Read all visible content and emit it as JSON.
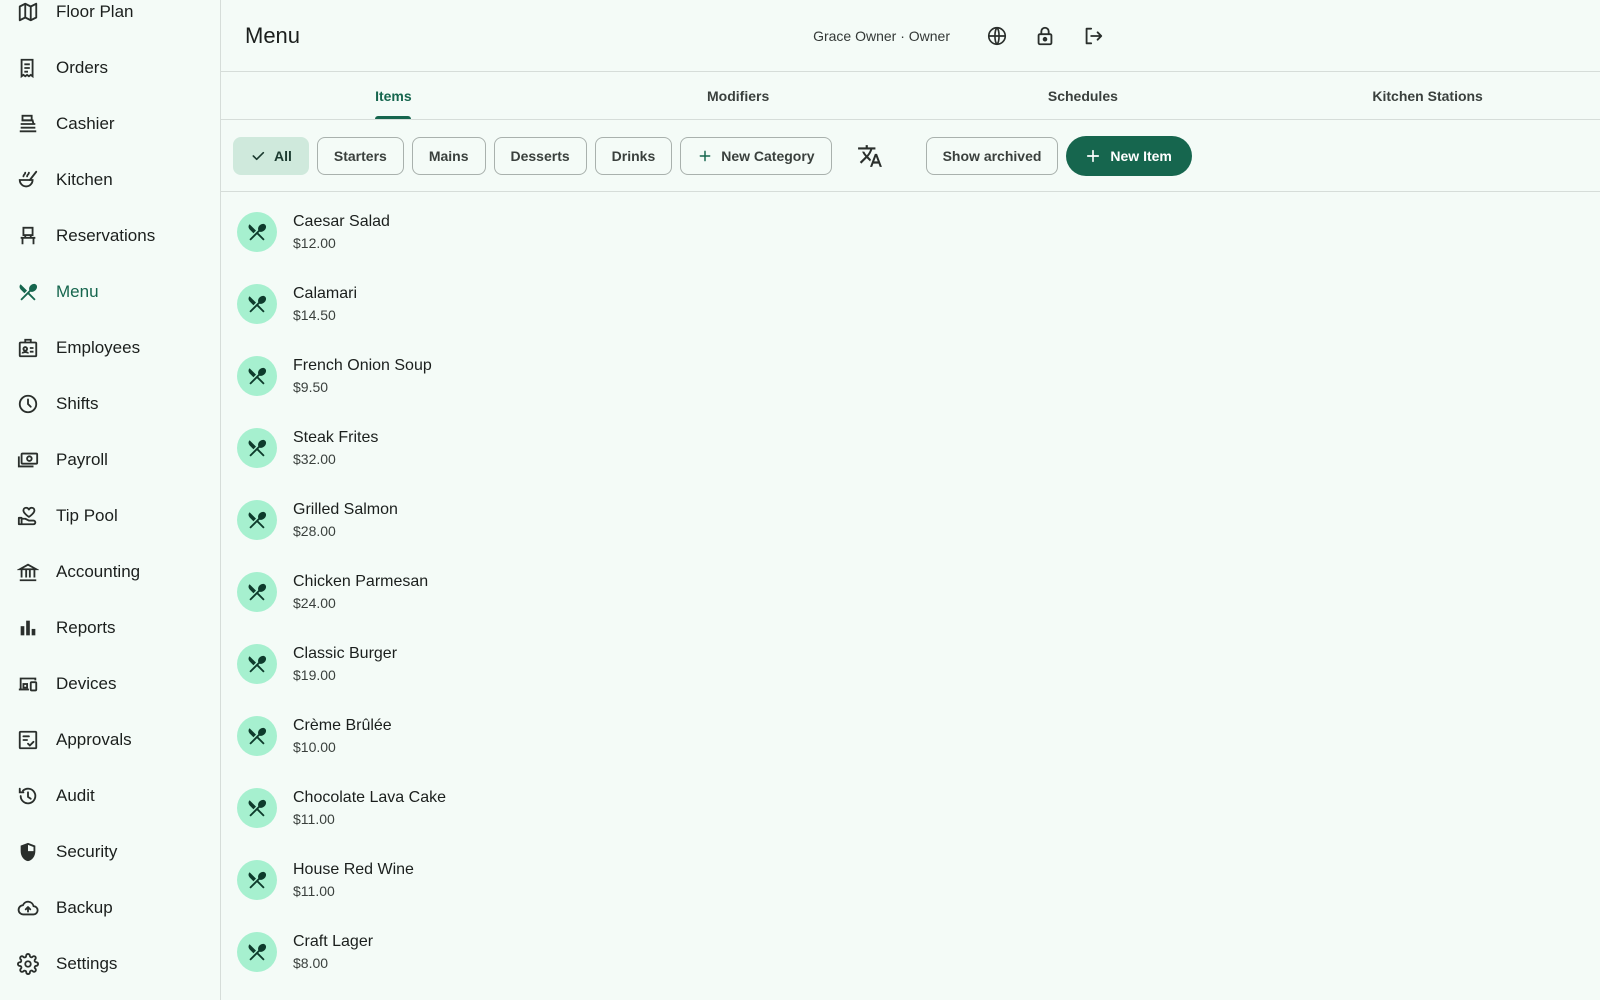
{
  "sidebar": {
    "items": [
      {
        "label": "Floor Plan",
        "icon": "map-icon"
      },
      {
        "label": "Orders",
        "icon": "receipt-icon"
      },
      {
        "label": "Cashier",
        "icon": "cash-register-icon"
      },
      {
        "label": "Kitchen",
        "icon": "soup-icon"
      },
      {
        "label": "Reservations",
        "icon": "chair-icon"
      },
      {
        "label": "Menu",
        "icon": "utensils-icon",
        "active": true
      },
      {
        "label": "Employees",
        "icon": "badge-icon"
      },
      {
        "label": "Shifts",
        "icon": "clock-icon"
      },
      {
        "label": "Payroll",
        "icon": "payments-icon"
      },
      {
        "label": "Tip Pool",
        "icon": "hand-heart-icon"
      },
      {
        "label": "Accounting",
        "icon": "bank-icon"
      },
      {
        "label": "Reports",
        "icon": "bar-chart-icon"
      },
      {
        "label": "Devices",
        "icon": "devices-icon"
      },
      {
        "label": "Approvals",
        "icon": "checklist-icon"
      },
      {
        "label": "Audit",
        "icon": "history-icon"
      },
      {
        "label": "Security",
        "icon": "shield-icon"
      },
      {
        "label": "Backup",
        "icon": "cloud-upload-icon"
      },
      {
        "label": "Settings",
        "icon": "gear-icon"
      }
    ]
  },
  "header": {
    "title": "Menu",
    "user": "Grace Owner · Owner"
  },
  "tabs": [
    {
      "label": "Items",
      "active": true
    },
    {
      "label": "Modifiers"
    },
    {
      "label": "Schedules"
    },
    {
      "label": "Kitchen Stations"
    }
  ],
  "toolbar": {
    "categories": [
      "All",
      "Starters",
      "Mains",
      "Desserts",
      "Drinks"
    ],
    "new_category": "New Category",
    "show_archived": "Show archived",
    "new_item": "New Item"
  },
  "items": [
    {
      "name": "Caesar Salad",
      "price": "$12.00"
    },
    {
      "name": "Calamari",
      "price": "$14.50"
    },
    {
      "name": "French Onion Soup",
      "price": "$9.50"
    },
    {
      "name": "Steak Frites",
      "price": "$32.00"
    },
    {
      "name": "Grilled Salmon",
      "price": "$28.00"
    },
    {
      "name": "Chicken Parmesan",
      "price": "$24.00"
    },
    {
      "name": "Classic Burger",
      "price": "$19.00"
    },
    {
      "name": "Crème Brûlée",
      "price": "$10.00"
    },
    {
      "name": "Chocolate Lava Cake",
      "price": "$11.00"
    },
    {
      "name": "House Red Wine",
      "price": "$11.00"
    },
    {
      "name": "Craft Lager",
      "price": "$8.00"
    }
  ],
  "colors": {
    "accent": "#16664e",
    "avatar_bg": "#a6f0cf",
    "chip_selected_bg": "#cfe9dc",
    "background": "#f4fbf7"
  }
}
